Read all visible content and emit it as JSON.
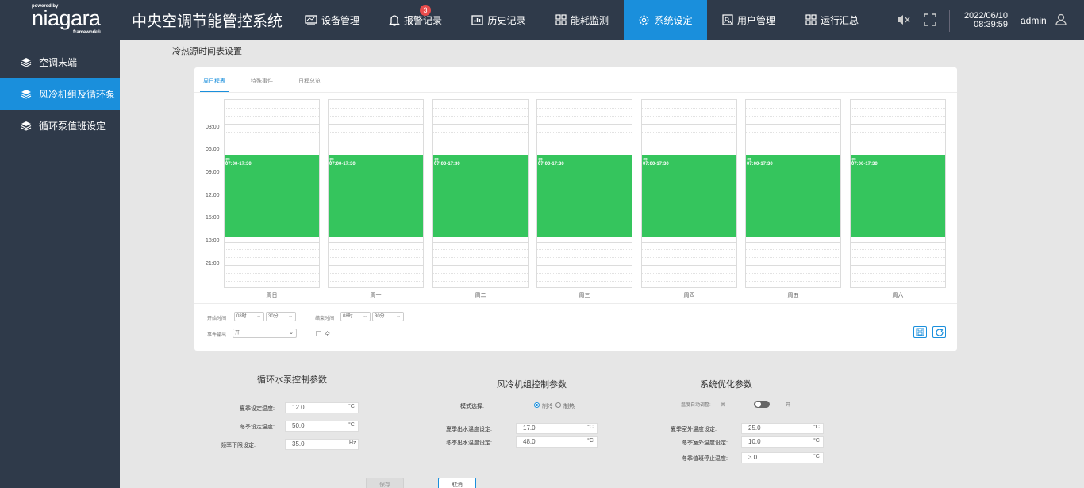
{
  "logo": {
    "powered_by": "powered by",
    "name": "niagara",
    "framework": "framework®"
  },
  "header": {
    "title": "中央空调节能管控系统",
    "nav": [
      {
        "label": "设备管理",
        "icon": "monitor-icon"
      },
      {
        "label": "报警记录",
        "icon": "bell-icon",
        "badge": "3"
      },
      {
        "label": "历史记录",
        "icon": "chart-icon"
      },
      {
        "label": "能耗监测",
        "icon": "grid-icon"
      },
      {
        "label": "系统设定",
        "icon": "gear-icon",
        "active": true
      },
      {
        "label": "用户管理",
        "icon": "user-manage-icon"
      },
      {
        "label": "运行汇总",
        "icon": "grid-icon"
      }
    ],
    "date": "2022/06/10",
    "time": "08:39:59",
    "user": "admin"
  },
  "sidebar": {
    "items": [
      {
        "label": "空调末端"
      },
      {
        "label": "风冷机组及循环泵",
        "active": true
      },
      {
        "label": "循环泵值班设定"
      }
    ]
  },
  "schedule": {
    "title": "冷热源时间表设置",
    "tabs": [
      "周日程表",
      "特殊事件",
      "日程总览"
    ],
    "y_labels": [
      "03:00",
      "06:00",
      "09:00",
      "12:00",
      "15:00",
      "18:00",
      "21:00"
    ],
    "days": [
      "周日",
      "周一",
      "周二",
      "周三",
      "周四",
      "周五",
      "周六"
    ],
    "event": {
      "state": "开",
      "range": "07:00-17:30"
    },
    "controls": {
      "start_label": "开始时间",
      "start_hour": "08时",
      "start_min": "30分",
      "end_label": "结束时间",
      "end_hour": "08时",
      "end_min": "30分",
      "output_label": "事件输出",
      "output_value": "开",
      "null_label": "空"
    }
  },
  "pump_params": {
    "title": "循环水泵控制参数",
    "rows": [
      {
        "label": "夏季设定温度:",
        "value": "12.0",
        "unit": "°C"
      },
      {
        "label": "冬季设定温度:",
        "value": "50.0",
        "unit": "°C"
      },
      {
        "label": "频率下限设定:",
        "value": "35.0",
        "unit": "Hz"
      }
    ]
  },
  "chiller_params": {
    "title": "风冷机组控制参数",
    "mode_label": "模式选择:",
    "mode_cool": "制冷",
    "mode_heat": "制热",
    "rows": [
      {
        "label": "夏季出水温度设定:",
        "value": "17.0",
        "unit": "°C"
      },
      {
        "label": "冬季出水温度设定:",
        "value": "48.0",
        "unit": "°C"
      }
    ]
  },
  "opt_params": {
    "title": "系统优化参数",
    "auto_label": "温度自动调整:",
    "off": "关",
    "on": "开",
    "rows": [
      {
        "label": "夏季室外温度设定:",
        "value": "25.0",
        "unit": "°C"
      },
      {
        "label": "冬季室外温度设定:",
        "value": "10.0",
        "unit": "°C"
      },
      {
        "label": "冬季值班停止温度:",
        "value": "3.0",
        "unit": "°C"
      }
    ]
  },
  "buttons": {
    "save": "保存",
    "cancel": "取消"
  }
}
